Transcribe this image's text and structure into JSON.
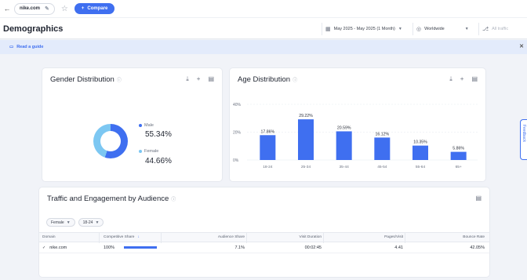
{
  "topbar": {
    "back_icon": "back-arrow-icon",
    "domain": "nike.com",
    "compare_label": "Compare"
  },
  "header": {
    "title": "Demographics",
    "date_range": "May 2025 - May 2025 (1 Month)",
    "region": "Worldwide",
    "traffic_filter": "All traffic"
  },
  "guide": {
    "label": "Read a guide"
  },
  "gender": {
    "title": "Gender Distribution",
    "male_label": "Male",
    "male_value": "55.34%",
    "female_label": "Female",
    "female_value": "44.66%",
    "colors": {
      "male": "#3f6ff0",
      "female": "#7cc7f2"
    }
  },
  "chart_data": {
    "type": "bar",
    "title": "Age Distribution",
    "categories": [
      "18-24",
      "25-34",
      "35-44",
      "45-54",
      "55-64",
      "65+"
    ],
    "values": [
      17.86,
      29.22,
      20.59,
      16.12,
      10.35,
      5.86
    ],
    "value_labels": [
      "17.86%",
      "29.22%",
      "20.59%",
      "16.12%",
      "10.35%",
      "5.86%"
    ],
    "y_ticks": [
      "0%",
      "20%",
      "40%"
    ],
    "ylim": [
      0,
      40
    ],
    "grid": true,
    "bar_color": "#3f6ff0"
  },
  "traffic": {
    "title": "Traffic and Engagement by Audience",
    "gender_filter": "Female",
    "age_filter": "18-24",
    "columns": [
      "Domain",
      "Competitive Share",
      "Audience Share",
      "Visit Duration",
      "Pages/Visit",
      "Bounce Rate"
    ],
    "rows": [
      {
        "domain": "nike.com",
        "competitive_share": "100%",
        "competitive_share_fraction": 1.0,
        "audience_share": "7.1%",
        "visit_duration": "00:02:45",
        "pages_visit": "4.41",
        "bounce_rate": "42.05%"
      }
    ]
  },
  "feedback": {
    "label": "Feedback"
  }
}
